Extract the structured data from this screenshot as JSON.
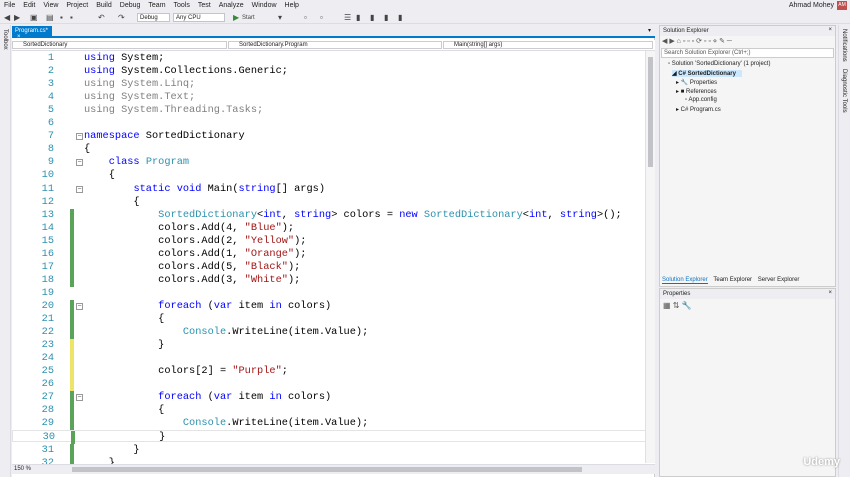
{
  "menu": [
    "File",
    "Edit",
    "View",
    "Project",
    "Build",
    "Debug",
    "Team",
    "Tools",
    "Test",
    "Analyze",
    "Window",
    "Help"
  ],
  "user": "Ahmad Mohey",
  "avatar": "AM",
  "toolbar": {
    "config": "Debug",
    "platform": "Any CPU",
    "start": "Start"
  },
  "left_strip": "Toolbox",
  "editor": {
    "tab": "Program.cs*",
    "nav": [
      "SortedDictionary",
      "SortedDictionary.Program",
      "Main(string[] args)"
    ],
    "zoom": "150 %",
    "lines": [
      [
        [
          "kw",
          "using"
        ],
        [
          "pl",
          " System;"
        ]
      ],
      [
        [
          "kw",
          "using"
        ],
        [
          "pl",
          " System.Collections.Generic;"
        ]
      ],
      [
        [
          "gr",
          "using System.Linq;"
        ]
      ],
      [
        [
          "gr",
          "using System.Text;"
        ]
      ],
      [
        [
          "gr",
          "using System.Threading.Tasks;"
        ]
      ],
      [],
      [
        [
          "kw",
          "namespace"
        ],
        [
          "pl",
          " SortedDictionary"
        ]
      ],
      [
        [
          "pl",
          "{"
        ]
      ],
      [
        [
          "pl",
          "    "
        ],
        [
          "kw",
          "class"
        ],
        [
          "pl",
          " "
        ],
        [
          "ty",
          "Program"
        ]
      ],
      [
        [
          "pl",
          "    {"
        ]
      ],
      [
        [
          "pl",
          "        "
        ],
        [
          "kw",
          "static void"
        ],
        [
          "pl",
          " Main("
        ],
        [
          "kw",
          "string"
        ],
        [
          "pl",
          "[] args)"
        ]
      ],
      [
        [
          "pl",
          "        {"
        ]
      ],
      [
        [
          "pl",
          "            "
        ],
        [
          "ty",
          "SortedDictionary"
        ],
        [
          "pl",
          "<"
        ],
        [
          "kw",
          "int"
        ],
        [
          "pl",
          ", "
        ],
        [
          "kw",
          "string"
        ],
        [
          "pl",
          "> colors = "
        ],
        [
          "kw",
          "new"
        ],
        [
          "pl",
          " "
        ],
        [
          "ty",
          "SortedDictionary"
        ],
        [
          "pl",
          "<"
        ],
        [
          "kw",
          "int"
        ],
        [
          "pl",
          ", "
        ],
        [
          "kw",
          "string"
        ],
        [
          "pl",
          ">();"
        ]
      ],
      [
        [
          "pl",
          "            colors.Add(4, "
        ],
        [
          "st",
          "\"Blue\""
        ],
        [
          "pl",
          ");"
        ]
      ],
      [
        [
          "pl",
          "            colors.Add(2, "
        ],
        [
          "st",
          "\"Yellow\""
        ],
        [
          "pl",
          ");"
        ]
      ],
      [
        [
          "pl",
          "            colors.Add(1, "
        ],
        [
          "st",
          "\"Orange\""
        ],
        [
          "pl",
          ");"
        ]
      ],
      [
        [
          "pl",
          "            colors.Add(5, "
        ],
        [
          "st",
          "\"Black\""
        ],
        [
          "pl",
          ");"
        ]
      ],
      [
        [
          "pl",
          "            colors.Add(3, "
        ],
        [
          "st",
          "\"White\""
        ],
        [
          "pl",
          ");"
        ]
      ],
      [],
      [
        [
          "pl",
          "            "
        ],
        [
          "kw",
          "foreach"
        ],
        [
          "pl",
          " ("
        ],
        [
          "kw",
          "var"
        ],
        [
          "pl",
          " item "
        ],
        [
          "kw",
          "in"
        ],
        [
          "pl",
          " colors)"
        ]
      ],
      [
        [
          "pl",
          "            {"
        ]
      ],
      [
        [
          "pl",
          "                "
        ],
        [
          "ty",
          "Console"
        ],
        [
          "pl",
          ".WriteLine(item.Value);"
        ]
      ],
      [
        [
          "pl",
          "            }"
        ]
      ],
      [],
      [
        [
          "pl",
          "            colors[2] = "
        ],
        [
          "st",
          "\"Purple\""
        ],
        [
          "pl",
          ";"
        ]
      ],
      [],
      [
        [
          "pl",
          "            "
        ],
        [
          "kw",
          "foreach"
        ],
        [
          "pl",
          " ("
        ],
        [
          "kw",
          "var"
        ],
        [
          "pl",
          " item "
        ],
        [
          "kw",
          "in"
        ],
        [
          "pl",
          " colors)"
        ]
      ],
      [
        [
          "pl",
          "            {"
        ]
      ],
      [
        [
          "pl",
          "                "
        ],
        [
          "ty",
          "Console"
        ],
        [
          "pl",
          ".WriteLine(item.Value);"
        ]
      ],
      [
        [
          "pl",
          "            }"
        ]
      ],
      [
        [
          "pl",
          "        }"
        ]
      ],
      [
        [
          "pl",
          "    }"
        ]
      ]
    ]
  },
  "solution_explorer": {
    "title": "Solution Explorer",
    "search": "Search Solution Explorer (Ctrl+;)",
    "items": [
      "Solution 'SortedDictionary' (1 project)",
      "SortedDictionary",
      "Properties",
      "References",
      "App.config",
      "Program.cs"
    ],
    "tabs": [
      "Solution Explorer",
      "Team Explorer",
      "Server Explorer"
    ]
  },
  "properties": {
    "title": "Properties"
  },
  "right_strip": [
    "Notifications",
    "Diagnostic Tools"
  ],
  "watermark": "Udemy"
}
